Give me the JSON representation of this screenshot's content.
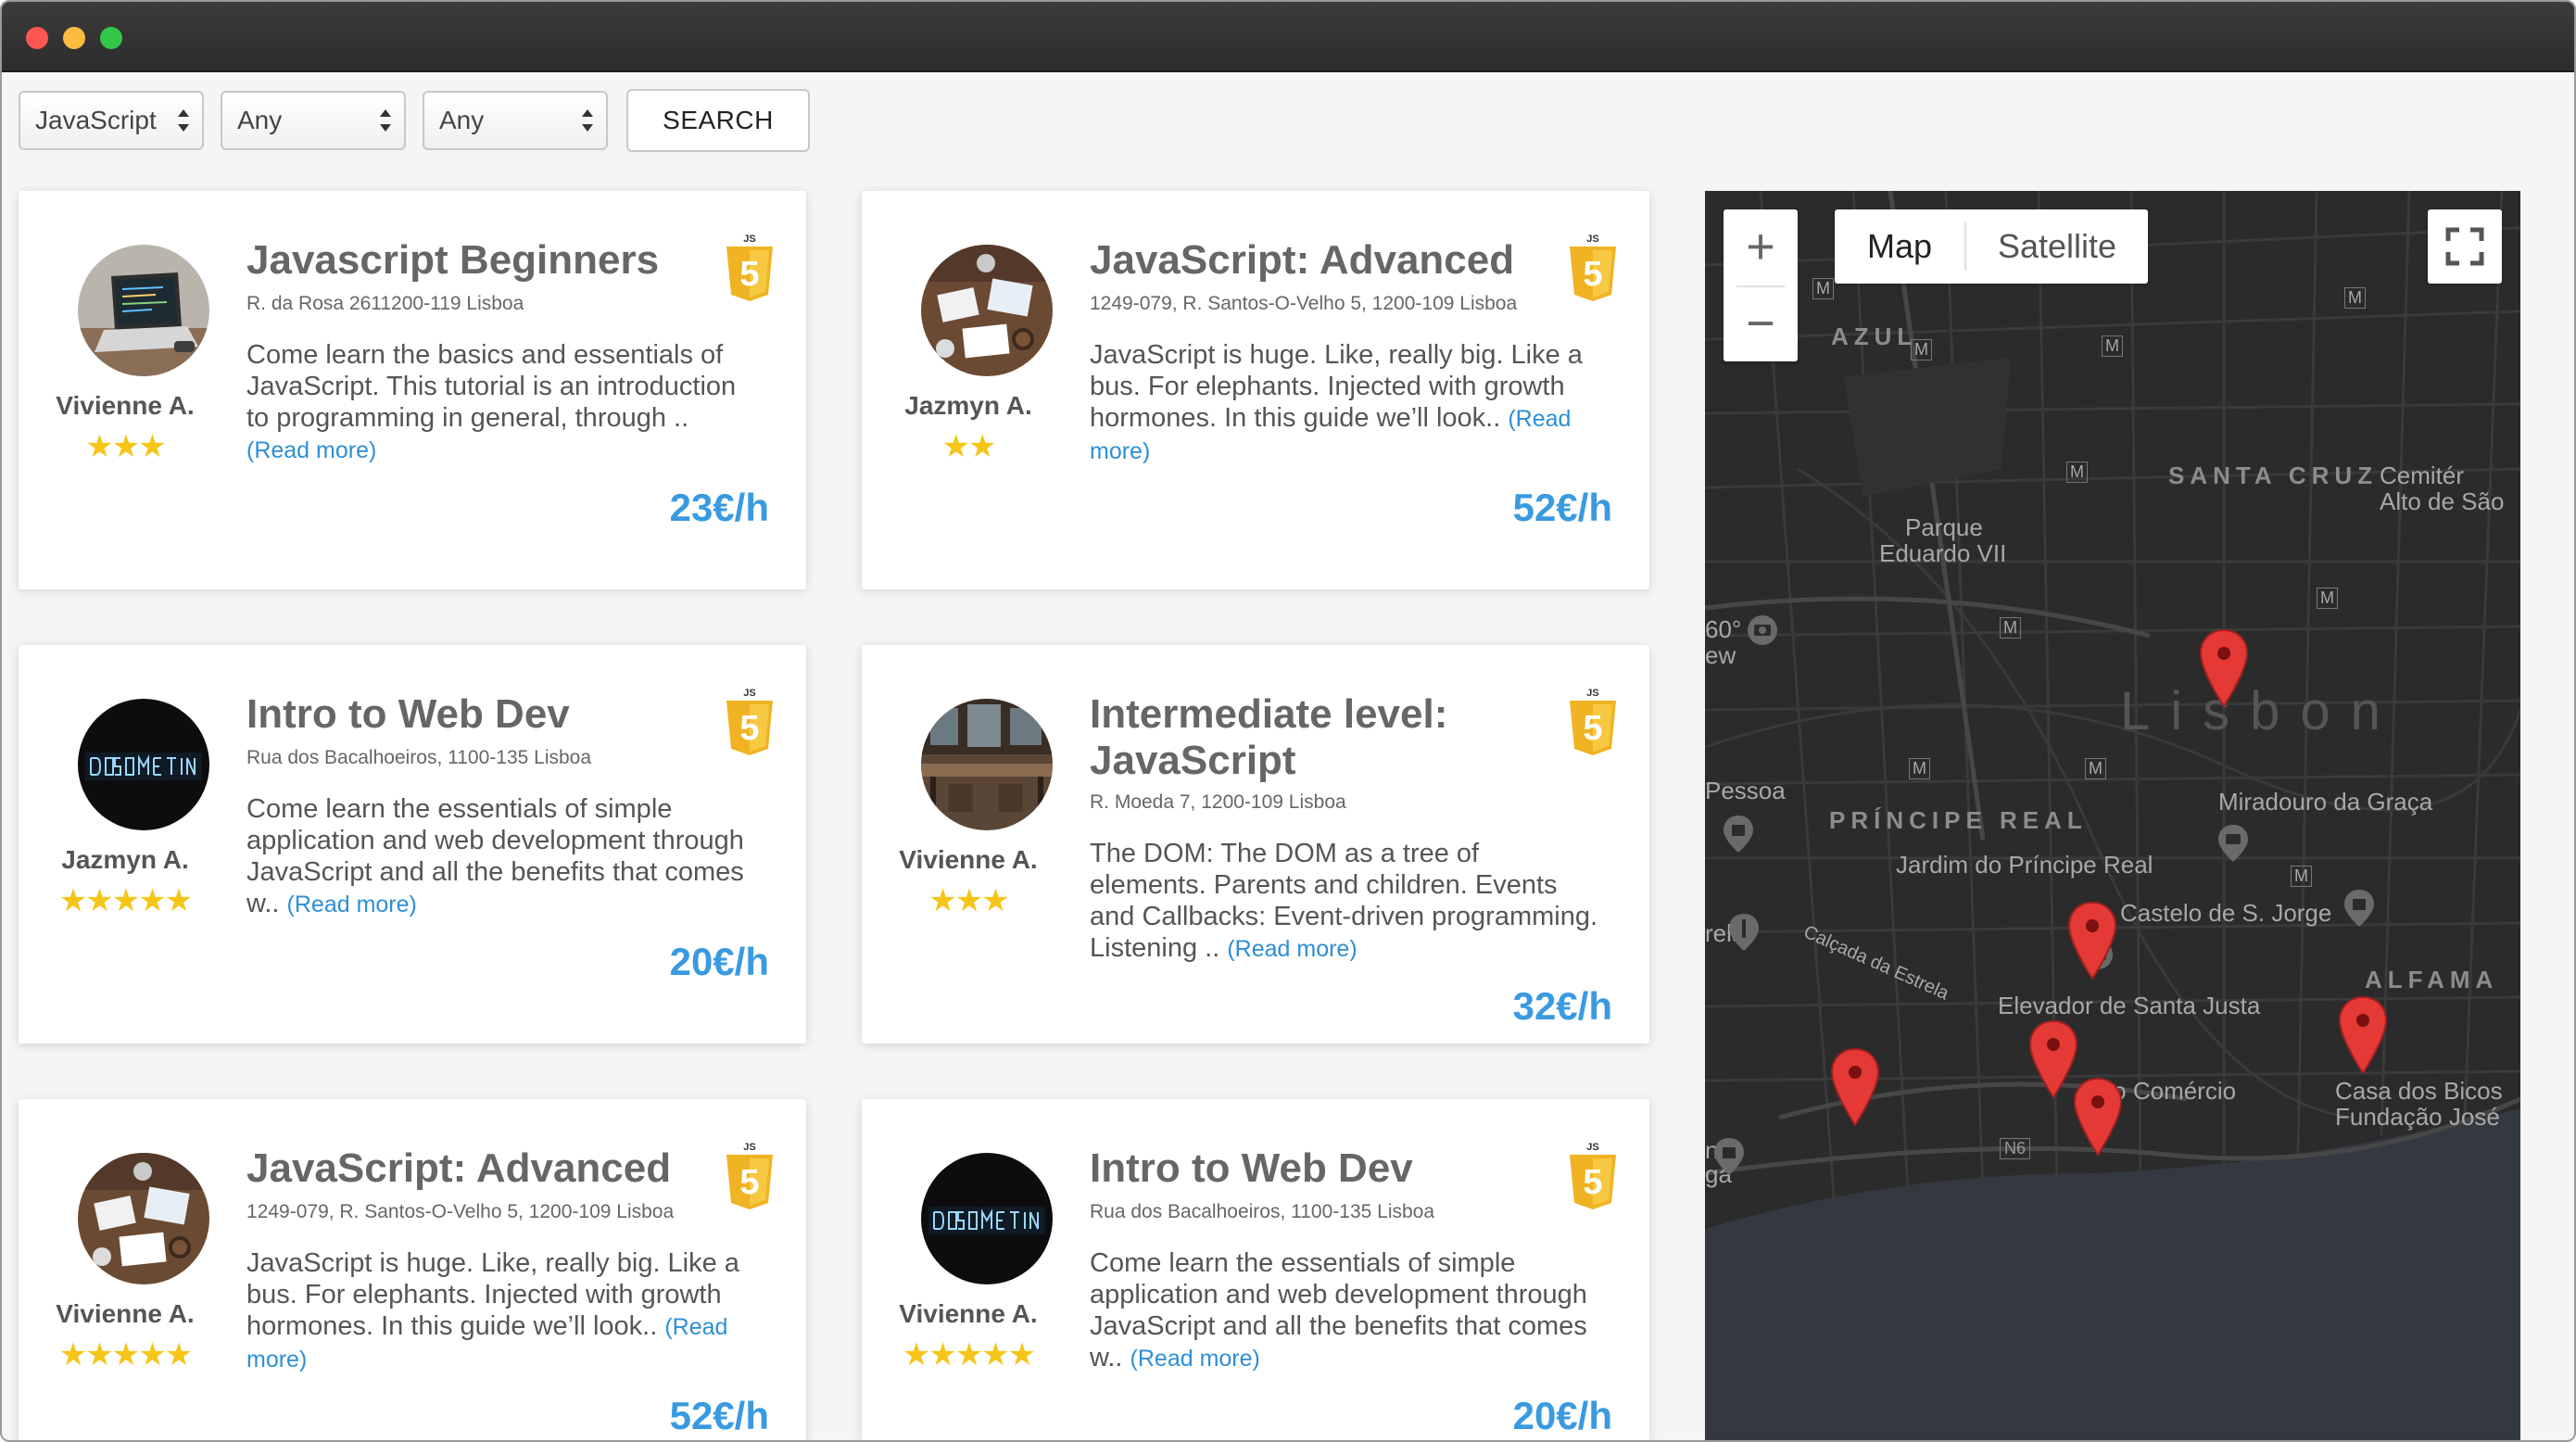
{
  "filters": {
    "language": "JavaScript",
    "filter2": "Any",
    "filter3": "Any",
    "search_label": "SEARCH"
  },
  "cards": [
    {
      "title": "Javascript Beginners",
      "address": "R. da Rosa 2611200-119 Lisboa",
      "description": "Come learn the basics and essentials of JavaScript. This tutorial is an introduction to programming in general, through ..",
      "read_more": "(Read more)",
      "author": "Vivienne A.",
      "rating": 3,
      "stars": "★★★",
      "price": "23€/h",
      "avatar": "laptop-avatar"
    },
    {
      "title": "JavaScript: Advanced",
      "address": "1249-079, R. Santos-O-Velho 5, 1200-109 Lisboa",
      "description": "JavaScript is huge. Like, really big. Like a bus. For elephants. Injected with growth hormones. In this guide we’ll look..",
      "read_more": "(Read more)",
      "author": "Jazmyn A.",
      "rating": 2,
      "stars": "★★",
      "price": "52€/h",
      "avatar": "desk-avatar"
    },
    {
      "title": "Intro to Web Dev",
      "address": "Rua dos Bacalhoeiros, 1100-135 Lisboa",
      "description": "Come learn the essentials of simple application and web development through JavaScript and all the benefits that comes w..",
      "read_more": "(Read more)",
      "author": "Jazmyn A.",
      "rating": 5,
      "stars": "★★★★★",
      "price": "20€/h",
      "avatar": "neon-avatar"
    },
    {
      "title": "Intermediate level: JavaScript",
      "address": "R. Moeda 7, 1200-109 Lisboa",
      "description": "The DOM: The DOM as a tree of elements. Parents and children. Events and Callbacks: Event-driven programming. Listening ..",
      "read_more": "(Read more)",
      "author": "Vivienne A.",
      "rating": 3,
      "stars": "★★★",
      "price": "32€/h",
      "avatar": "office-avatar"
    },
    {
      "title": "JavaScript: Advanced",
      "address": "1249-079, R. Santos-O-Velho 5, 1200-109 Lisboa",
      "description": "JavaScript is huge. Like, really big. Like a bus. For elephants. Injected with growth hormones. In this guide we’ll look..",
      "read_more": "(Read more)",
      "author": "Vivienne A.",
      "rating": 5,
      "stars": "★★★★★",
      "price": "52€/h",
      "avatar": "desk-avatar"
    },
    {
      "title": "Intro to Web Dev",
      "address": "Rua dos Bacalhoeiros, 1100-135 Lisboa",
      "description": "Come learn the essentials of simple application and web development through JavaScript and all the benefits that comes w..",
      "read_more": "(Read more)",
      "author": "Vivienne A.",
      "rating": 5,
      "stars": "★★★★★",
      "price": "20€/h",
      "avatar": "neon-avatar"
    }
  ],
  "badge": {
    "label": "JS",
    "number": "5"
  },
  "map": {
    "zoom_in": "+",
    "zoom_out": "−",
    "type_map": "Map",
    "type_satellite": "Satellite",
    "labels": {
      "azul": "AZUL",
      "santa_cruz": "SANTA CRUZ",
      "cemiterio": "Cemitér",
      "alto_sao": "Alto de São",
      "parque": "Parque",
      "eduardo": "Eduardo VII",
      "lisbon": "Lisbon",
      "principe_real": "PRÍNCIPE REAL",
      "miradouro": "Miradouro da Graça",
      "jardim": "Jardim do Príncipe Real",
      "castelo": "Castelo de S. Jorge",
      "pessoa": "Pessoa",
      "estrela": "Calçada da Estrela",
      "rela": "rela",
      "alfama": "ALFAMA",
      "elevador": "Elevador de Santa Justa",
      "comercio": "a do Comércio",
      "casa": "Casa dos Bicos",
      "fundacao": "Fundação José",
      "n6": "N6",
      "ew": "ew",
      "deg": "60°",
      "nal": "nal",
      "ga": "ga",
      "metro": "M"
    },
    "colors": {
      "land": "#2b2b2b",
      "water": "#343841",
      "pin": "#e53935"
    }
  }
}
